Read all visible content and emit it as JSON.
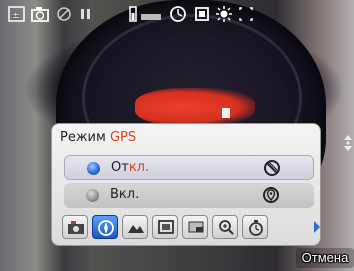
{
  "gps_dialog": {
    "title_prefix": "Режим ",
    "title_highlight": "GPS",
    "options": [
      {
        "label_prefix": "От",
        "label_highlight": "кл.",
        "selected": true,
        "icon": "gps-off-icon"
      },
      {
        "label_prefix": "Вкл.",
        "label_highlight": "",
        "selected": false,
        "icon": "gps-on-icon"
      }
    ]
  },
  "toolbar": {
    "items": [
      {
        "icon": "camera-mode-icon",
        "active": false
      },
      {
        "icon": "gps-compass-icon",
        "active": true
      },
      {
        "icon": "landscape-scene-icon",
        "active": false
      },
      {
        "icon": "frame-icon",
        "active": false
      },
      {
        "icon": "aspect-ratio-icon",
        "active": false
      },
      {
        "icon": "zoom-icon",
        "active": false
      },
      {
        "icon": "timer-icon",
        "active": false
      }
    ]
  },
  "cancel": {
    "label": "Отмена"
  },
  "status_bar": {
    "icons": [
      "exposure-icon",
      "camera-icon",
      "flash-icon",
      "pause-icon",
      "battery-icon",
      "storage-icon",
      "self-timer-icon",
      "stabilizer-icon",
      "white-balance-icon",
      "focus-bracket-icon"
    ]
  },
  "colors": {
    "accent": "#e04020",
    "selected_radio": "#2a6fd8"
  }
}
